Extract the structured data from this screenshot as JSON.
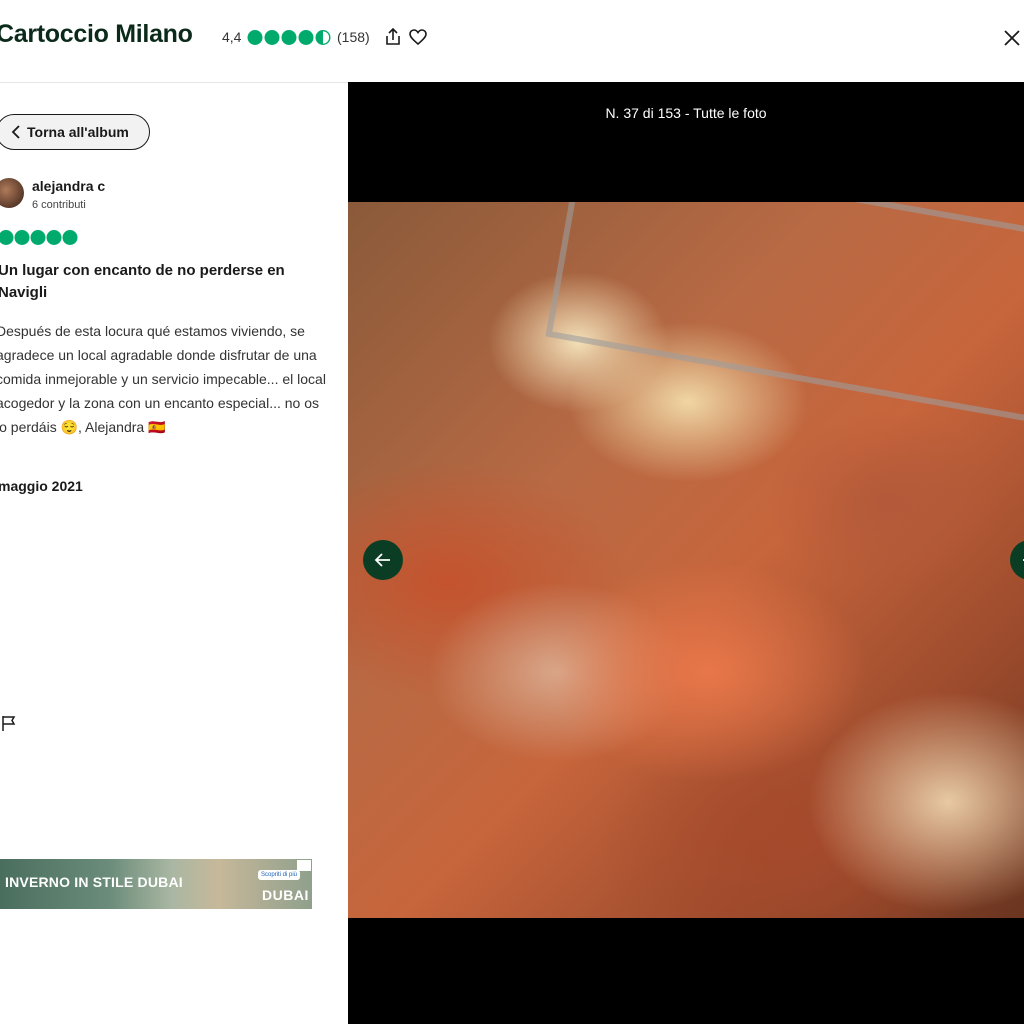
{
  "header": {
    "title": "Cartoccio Milano",
    "rating": "4,4",
    "rating_value": 4.4,
    "reviews_count": "(158)",
    "icons": [
      "share-icon",
      "heart-icon",
      "close-icon"
    ]
  },
  "review": {
    "back_label": "Torna all'album",
    "user_name": "alejandra c",
    "contributions": "6 contributi",
    "rating_value": 5,
    "title": "Un lugar con encanto de no perderse en Navigli",
    "body": "Después de esta locura qué estamos viviendo, se agradece un local agradable donde disfrutar de una comida inmejorable y un servicio impecable... el local acogedor y la zona con un encanto especial... no os lo perdáis 😌, Alejandra 🇪🇸",
    "date": "maggio 2021"
  },
  "ad": {
    "text": "INVERNO IN STILE DUBAI",
    "cta": "Scopriti di più",
    "brand": "DUBAI"
  },
  "viewer": {
    "counter": "N. 37 di 153 - Tutte le foto"
  },
  "colors": {
    "brand_green": "#00aa6c",
    "dark_green": "#0b3d24",
    "viewer_bg": "#000000"
  }
}
